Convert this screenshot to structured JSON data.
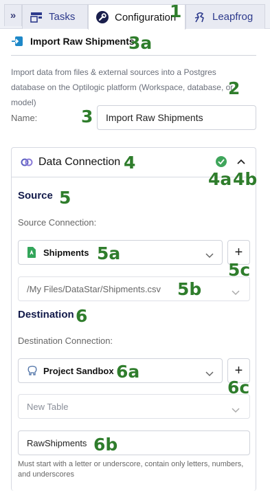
{
  "tabs": {
    "collapse": "»",
    "items": [
      {
        "label": "Tasks",
        "icon": "tasks-icon"
      },
      {
        "label": "Configuration",
        "icon": "wrench-icon",
        "active": true
      },
      {
        "label": "Leapfrog",
        "icon": "leapfrog-icon"
      }
    ]
  },
  "task": {
    "title": "Import Raw Shipments",
    "icon": "import-icon",
    "description": "Import data from files & external sources into a Postgres database on the Optilogic platform (Workspace, database, or model)"
  },
  "name_field": {
    "label": "Name:",
    "value": "Import Raw Shipments"
  },
  "data_connection": {
    "title": "Data Connection",
    "status": "connected",
    "source": {
      "title": "Source",
      "connection_label": "Source Connection:",
      "connection_value": "Shipments",
      "file_path": "/My Files/DataStar/Shipments.csv",
      "add_label": "+"
    },
    "destination": {
      "title": "Destination",
      "connection_label": "Destination Connection:",
      "connection_value": "Project Sandbox",
      "add_label": "+",
      "table_mode": "New Table",
      "table_name": "RawShipments",
      "hint": "Must start with a letter or underscore, contain only letters, numbers, and underscores"
    }
  },
  "annotations": {
    "a1": "1",
    "a2": "2",
    "a3": "3",
    "a3a": "3a",
    "a4": "4",
    "a4a": "4a",
    "a4b": "4b",
    "a5": "5",
    "a5a": "5a",
    "a5b": "5b",
    "a5c": "5c",
    "a6": "6",
    "a6a": "6a",
    "a6b": "6b",
    "a6c": "6c"
  },
  "colors": {
    "accent": "#2d3a8c",
    "annotation": "#2f7d2c",
    "success": "#3fa55b",
    "heading": "#121a4a"
  }
}
